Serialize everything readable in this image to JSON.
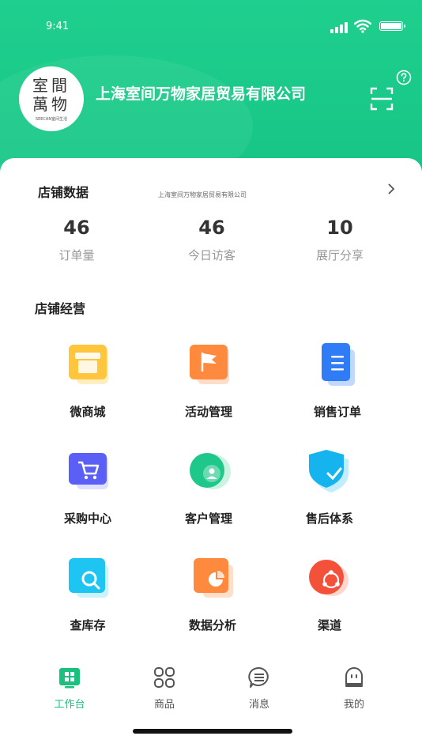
{
  "status_bar": {
    "time": "9:41"
  },
  "header": {
    "logo_line1": "室間",
    "logo_line2": "萬物",
    "logo_tagline": "SEECAN室间生活",
    "company_name": "上海室间万物家居贸易有限公司"
  },
  "store_data": {
    "title": "店铺数据",
    "subtitle": "上海室间万物家居贸易有限公司",
    "stats": [
      {
        "value": "46",
        "label": "订单量"
      },
      {
        "value": "46",
        "label": "今日访客"
      },
      {
        "value": "10",
        "label": "展厅分享"
      }
    ]
  },
  "operations": {
    "title": "店铺经营",
    "items": [
      {
        "label": "微商城",
        "icon": "store-icon"
      },
      {
        "label": "活动管理",
        "icon": "flag-icon"
      },
      {
        "label": "销售订单",
        "icon": "document-icon"
      },
      {
        "label": "采购中心",
        "icon": "cart-icon"
      },
      {
        "label": "客户管理",
        "icon": "user-icon"
      },
      {
        "label": "售后体系",
        "icon": "shield-check-icon"
      },
      {
        "label": "查库存",
        "icon": "search-icon"
      },
      {
        "label": "数据分析",
        "icon": "pie-chart-icon"
      },
      {
        "label": "渠道",
        "icon": "share-icon"
      }
    ]
  },
  "tabbar": {
    "items": [
      {
        "label": "工作台",
        "active": true
      },
      {
        "label": "商品",
        "active": false
      },
      {
        "label": "消息",
        "active": false
      },
      {
        "label": "我的",
        "active": false
      }
    ]
  },
  "colors": {
    "brand_green": "#1bc886",
    "active_tab": "#1bbf7e"
  }
}
